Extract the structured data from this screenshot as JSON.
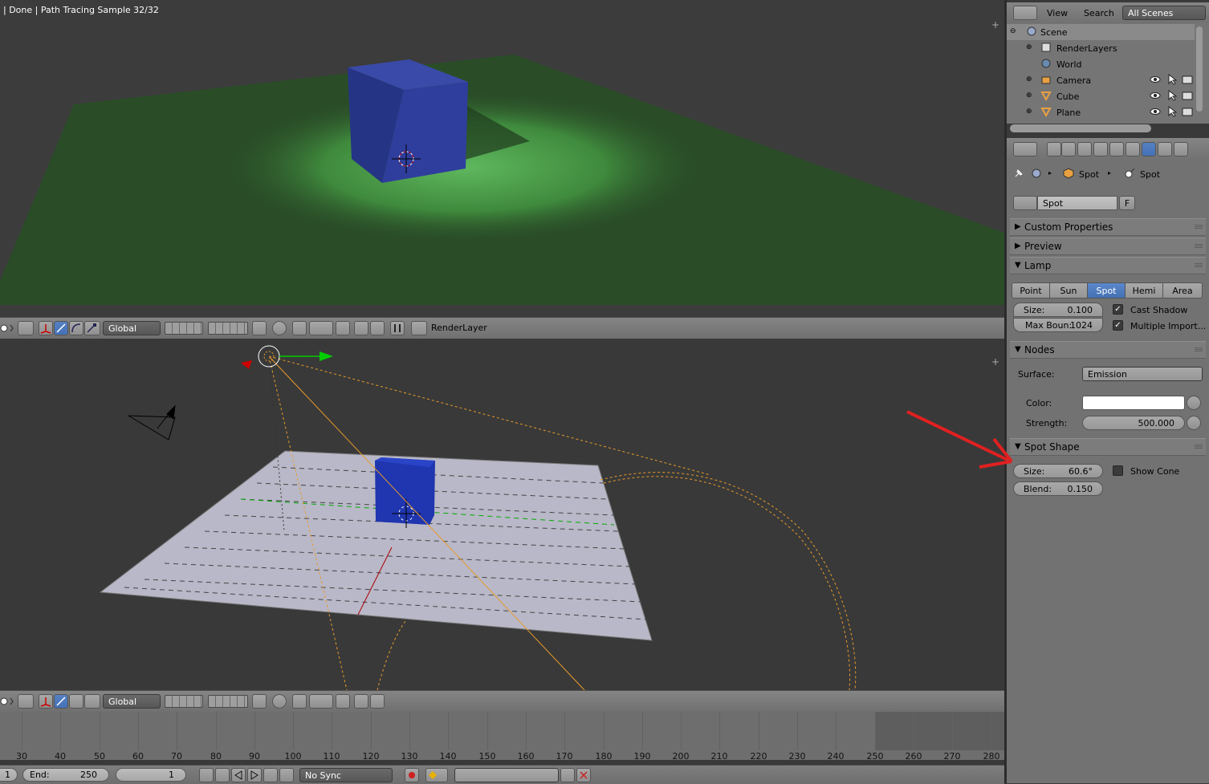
{
  "status": "| Done | Path Tracing Sample 32/32",
  "view3d_header": {
    "orientation": "Global",
    "render_layer": "RenderLayer"
  },
  "view3d_header_bottom": {
    "orientation": "Global"
  },
  "outliner": {
    "menu_view": "View",
    "menu_search": "Search",
    "display_mode": "All Scenes",
    "items": [
      {
        "label": "Scene"
      },
      {
        "label": "RenderLayers"
      },
      {
        "label": "World"
      },
      {
        "label": "Camera"
      },
      {
        "label": "Cube"
      },
      {
        "label": "Plane"
      }
    ]
  },
  "properties": {
    "breadcrumb_1": "Spot",
    "breadcrumb_2": "Spot",
    "datablock_name": "Spot",
    "fake_user": "F",
    "panels": {
      "custom_properties": "Custom Properties",
      "preview": "Preview",
      "lamp": "Lamp",
      "nodes": "Nodes",
      "spot_shape": "Spot Shape"
    },
    "lamp_types": [
      "Point",
      "Sun",
      "Spot",
      "Hemi",
      "Area"
    ],
    "lamp_active": "Spot",
    "lamp_size_label": "Size:",
    "lamp_size_value": "0.100",
    "max_bounce_label": "Max Boun:",
    "max_bounce_value": "1024",
    "cast_shadow": "Cast Shadow",
    "multiple_importance": "Multiple Import...",
    "surface_label": "Surface:",
    "surface_value": "Emission",
    "color_label": "Color:",
    "strength_label": "Strength:",
    "strength_value": "500.000",
    "spot_size_label": "Size:",
    "spot_size_value": "60.6°",
    "blend_label": "Blend:",
    "blend_value": "0.150",
    "show_cone": "Show Cone"
  },
  "timeline": {
    "frames": [
      "30",
      "40",
      "50",
      "60",
      "70",
      "80",
      "90",
      "100",
      "110",
      "120",
      "130",
      "140",
      "150",
      "160",
      "170",
      "180",
      "190",
      "200",
      "210",
      "220",
      "230",
      "240",
      "250",
      "260",
      "270",
      "280"
    ],
    "start_partial": "1",
    "end_label": "End:",
    "end_value": "250",
    "current_frame": "1",
    "sync": "No Sync"
  },
  "colors": {
    "annotation_arrow": "#e02020",
    "selection_blue": "#4a78bf"
  }
}
